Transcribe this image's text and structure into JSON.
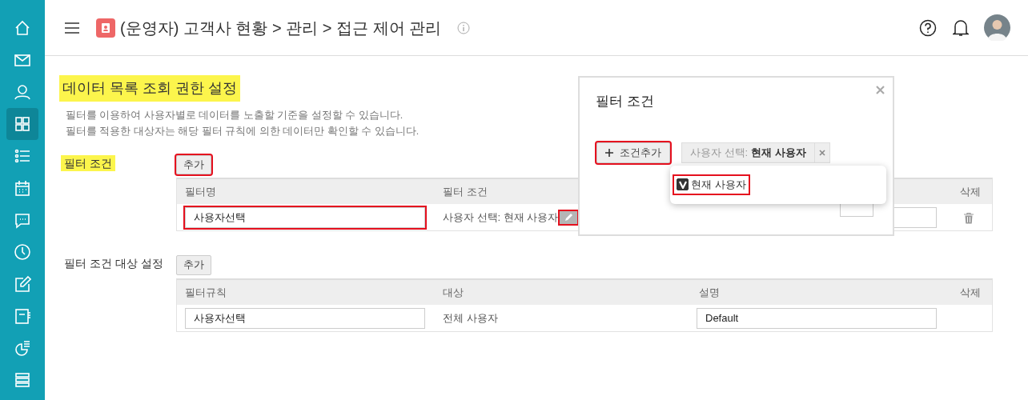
{
  "sidebar": {
    "items": [
      {
        "selected": false
      },
      {
        "selected": false
      },
      {
        "selected": false
      },
      {
        "selected": true
      },
      {
        "selected": false
      },
      {
        "selected": false
      },
      {
        "selected": false
      },
      {
        "selected": false
      },
      {
        "selected": false
      },
      {
        "selected": false
      },
      {
        "selected": false
      },
      {
        "selected": false
      }
    ]
  },
  "header": {
    "title": "(운영자) 고객사 현황 > 관리 > 접근 제어 관리"
  },
  "page": {
    "title": "데이터 목록 조회 권한 설정",
    "title_marked": true,
    "description": [
      "필터를 이용하여 사용자별로 데이터를 노출할 기준을 설정할 수 있습니다.",
      "필터를 적용한 대상자는 해당 필터 규칙에 의한 데이터만 확인할 수 있습니다."
    ]
  },
  "sections": [
    {
      "label": "필터 조건",
      "marked": true,
      "add_button": {
        "label": "추가",
        "highlighted": true
      },
      "columns": [
        "필터명",
        "필터 조건",
        null,
        "삭제"
      ],
      "rows": [
        {
          "name": {
            "value": "사용자선택",
            "highlighted": true
          },
          "condition": {
            "text": "사용자 선택: 현재 사용자",
            "edit_highlighted": true
          },
          "field_3": {},
          "delete": true
        }
      ]
    },
    {
      "label": "필터 조건 대상 설정",
      "marked": false,
      "add_button": {
        "label": "추가",
        "highlighted": false
      },
      "columns": [
        "필터규칙",
        "대상",
        "설명",
        "삭제"
      ],
      "rows": [
        {
          "name": {
            "value": "사용자선택",
            "highlighted": false
          },
          "target": "전체 사용자",
          "field_3": {
            "value": "Default"
          },
          "delete": false
        }
      ]
    }
  ],
  "modal": {
    "title": "필터 조건",
    "add_condition": {
      "label": "조건추가",
      "highlighted": true
    },
    "chip": {
      "label": "사용자 선택:",
      "value": "현재 사용자"
    },
    "dropdown": {
      "options": [
        {
          "label": "현재 사용자",
          "checked": true,
          "highlighted": true
        }
      ]
    }
  }
}
